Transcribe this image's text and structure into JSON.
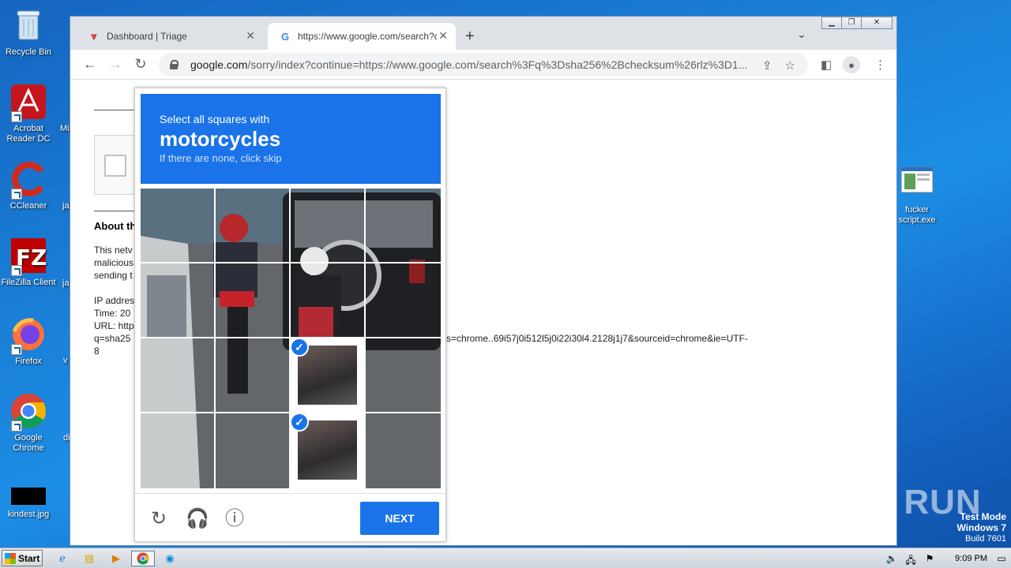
{
  "desktop": {
    "icons": [
      {
        "label": "Recycle Bin",
        "icon": "recycle-bin-icon"
      },
      {
        "label": "Acrobat Reader DC",
        "icon": "acrobat-icon"
      },
      {
        "label": "CCleaner",
        "icon": "ccleaner-icon"
      },
      {
        "label": "FileZilla Client",
        "icon": "filezilla-icon"
      },
      {
        "label": "Firefox",
        "icon": "firefox-icon"
      },
      {
        "label": "Google Chrome",
        "icon": "chrome-icon"
      },
      {
        "label": "kindest.jpg",
        "icon": "image-file-icon"
      },
      {
        "label": "fucker script.exe",
        "icon": "exe-file-icon"
      }
    ],
    "partial_labels": [
      "Mi",
      "ja",
      "ja",
      "v",
      "di"
    ],
    "watermark": "ANY RUN",
    "test_mode": {
      "line1": "Test Mode",
      "line2": "Windows 7",
      "line3": "Build 7601"
    }
  },
  "browser": {
    "tabs": [
      {
        "title": "Dashboard | Triage",
        "active": false
      },
      {
        "title": "https://www.google.com/search?q=",
        "active": true
      }
    ],
    "newtab_label": "+",
    "address": {
      "domain": "google.com",
      "path": "/sorry/index?continue=https://www.google.com/search%3Fq%3Dsha256%2Bchecksum%26rlz%3D1..."
    }
  },
  "page": {
    "about_heading": "About th",
    "para1": [
      "This netv",
      "malicious",
      "sending t"
    ],
    "para2": [
      "IP addres",
      "Time: 20",
      "URL: http",
      "q=sha25",
      "8"
    ],
    "url_tail": "s=chrome..69i57j0i512l5j0i22i30l4.2128j1j7&sourceid=chrome&ie=UTF-"
  },
  "captcha": {
    "prompt_small": "Select all squares with",
    "prompt_target": "motorcycles",
    "prompt_sub": "If there are none, click skip",
    "selected_tiles": [
      [
        2,
        2
      ],
      [
        3,
        2
      ]
    ],
    "next_label": "NEXT"
  },
  "taskbar": {
    "start_label": "Start",
    "clock": "9:09 PM"
  },
  "colors": {
    "accent": "#1a73e8",
    "desktop": "#1a7fd6"
  }
}
